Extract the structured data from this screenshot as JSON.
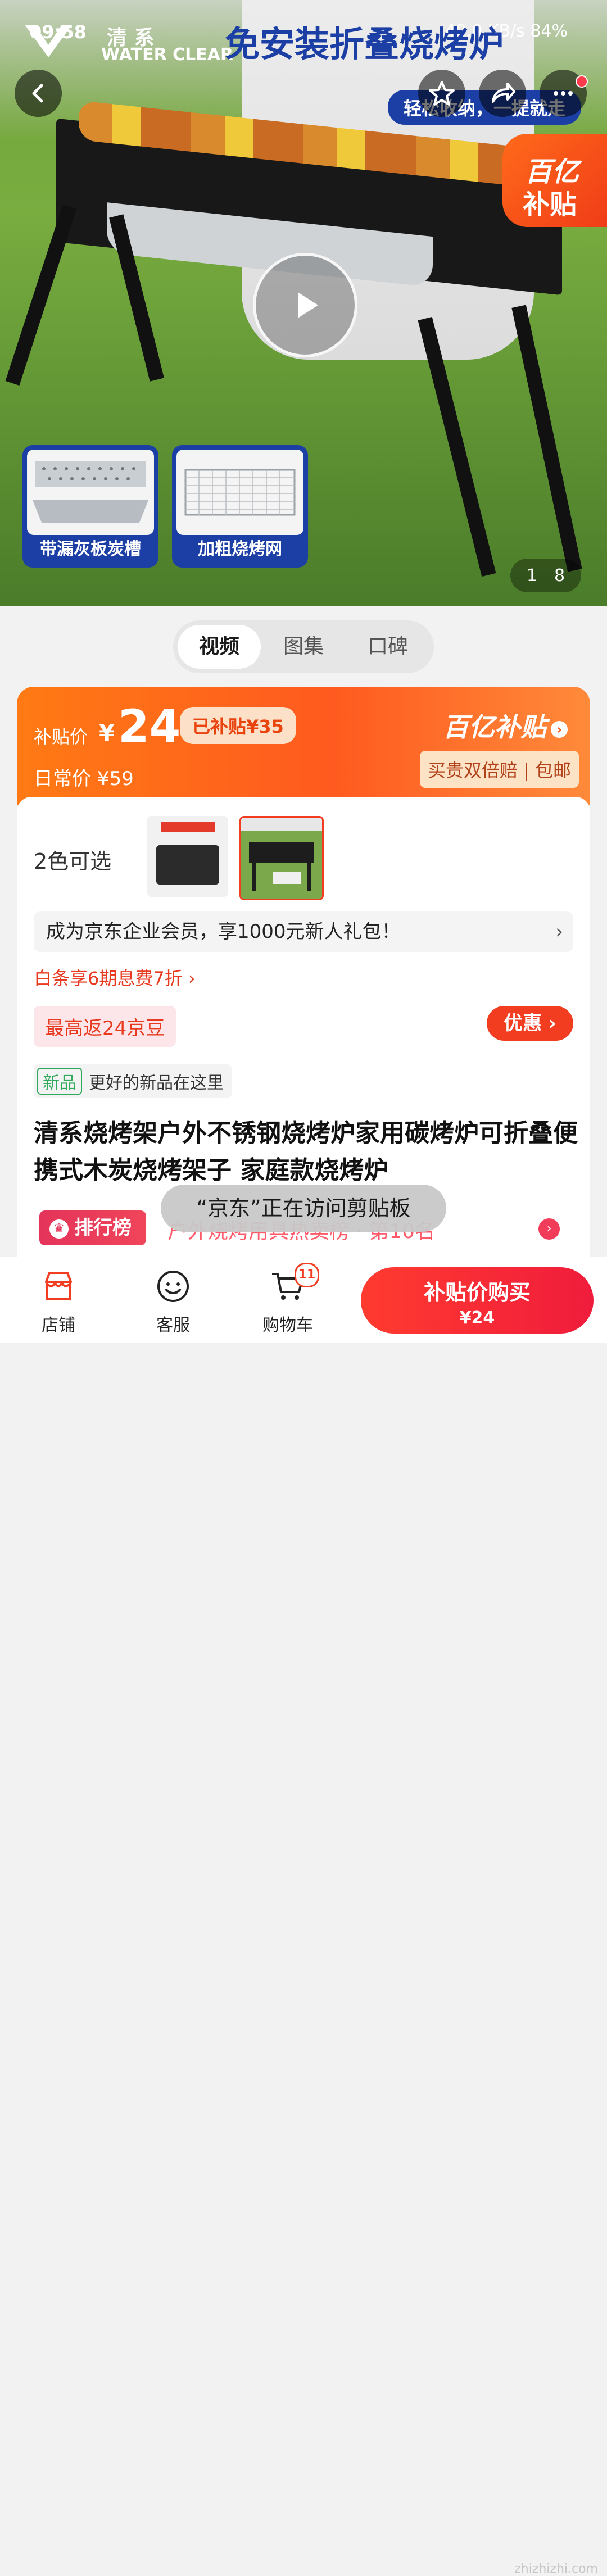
{
  "status": {
    "time": "09:58",
    "right": "40.0 KB/s 84%"
  },
  "hero": {
    "brand_cn": "清 系",
    "brand_en": "WATER CLEAR",
    "headline": "免安装折叠烧烤炉",
    "subhead": "轻松收纳，一提就走",
    "promo_badge_l1": "百亿",
    "promo_badge_l2": "补贴",
    "thumb1_caption": "带漏灰板炭槽",
    "thumb2_caption": "加粗烧烤网",
    "counter_current": "1",
    "counter_total": "8"
  },
  "tabs": [
    {
      "label": "视频"
    },
    {
      "label": "图集"
    },
    {
      "label": "口碑"
    }
  ],
  "price": {
    "label": "补贴价",
    "yen": "¥",
    "value": "24",
    "subsidy": "已补贴¥35",
    "daily_label": "日常价 ¥59",
    "brand": "百亿补贴",
    "guarantee": "买贵双倍赔 | 包邮"
  },
  "detail": {
    "color_label": "2色可选",
    "member_text": "成为京东企业会员，享1000元新人礼包！",
    "member_chevron": "›",
    "baitiao": "白条享6期息费7折 ›",
    "jingdou": "最高返24京豆",
    "coupon": "优惠 ›",
    "new_badge": "新品",
    "new_text": "更好的新品在这里",
    "title": "清系烧烤架户外不锈钢烧烤炉家用碳烤炉可折叠便携式木炭烧烤架子 家庭款烧烤炉",
    "rank_label": "排行榜",
    "rank_text": "户外烧烤用具热卖榜 · 第10名"
  },
  "toast": "“京东”正在访问剪贴板",
  "bottom": {
    "shop": "店铺",
    "service": "客服",
    "cart": "购物车",
    "cart_count": "11",
    "buy_line1": "补贴价购买",
    "buy_line2": "¥24"
  },
  "watermark": "zhizhizhi.com",
  "colors": {
    "accent": "#f23d20",
    "brand_blue": "#1c3fa6",
    "orange": "#ff6a1a"
  }
}
